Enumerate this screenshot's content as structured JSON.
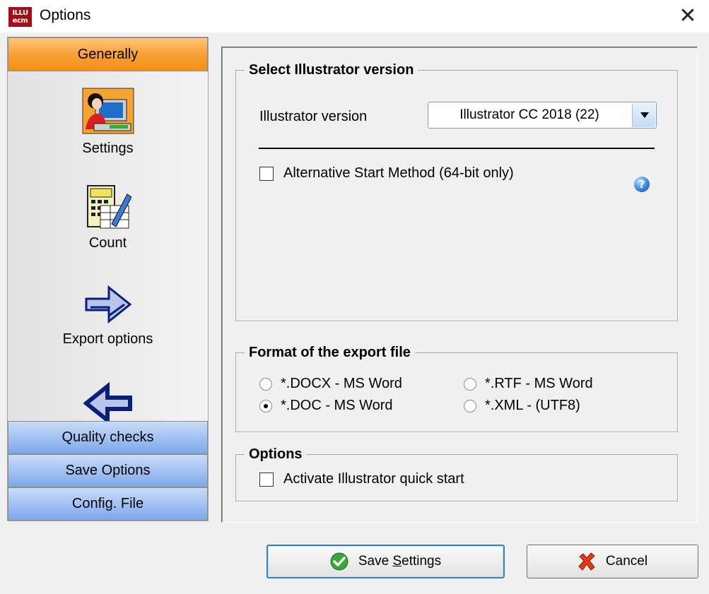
{
  "window": {
    "title": "Options",
    "app_icon_lines": [
      "ILLU",
      "ecm"
    ],
    "close_glyph": "✕"
  },
  "sidebar": {
    "active_header": "Generally",
    "nav_items": [
      {
        "label": "Settings",
        "icon": "user-computer-icon"
      },
      {
        "label": "Count",
        "icon": "calculator-pencil-icon"
      },
      {
        "label": "Export options",
        "icon": "arrow-right-icon"
      },
      {
        "label": "",
        "icon": "arrow-left-icon"
      }
    ],
    "bottom_headers": [
      "Quality checks",
      "Save Options",
      "Config. File"
    ]
  },
  "illustrator_group": {
    "title": "Select Illustrator version",
    "version_label": "Illustrator version",
    "version_value": "Illustrator CC 2018 (22)",
    "alt_start_label": "Alternative Start Method (64-bit only)",
    "alt_start_checked": false
  },
  "format_group": {
    "title": "Format of the export file",
    "options": [
      {
        "label": "*.DOCX - MS Word",
        "checked": false
      },
      {
        "label": "*.RTF - MS Word",
        "checked": false
      },
      {
        "label": "*.DOC - MS Word",
        "checked": true
      },
      {
        "label": "*.XML - (UTF8)",
        "checked": false
      }
    ]
  },
  "options_group": {
    "title": "Options",
    "quick_start_label": "Activate Illustrator quick start",
    "quick_start_checked": false
  },
  "buttons": {
    "save_pre": "Save ",
    "save_accel": "S",
    "save_post": "ettings",
    "cancel": "Cancel"
  },
  "colors": {
    "active_header": "#f7a12e",
    "inactive_header": "#a4c2f2",
    "accent_border": "#3c7fb1"
  }
}
